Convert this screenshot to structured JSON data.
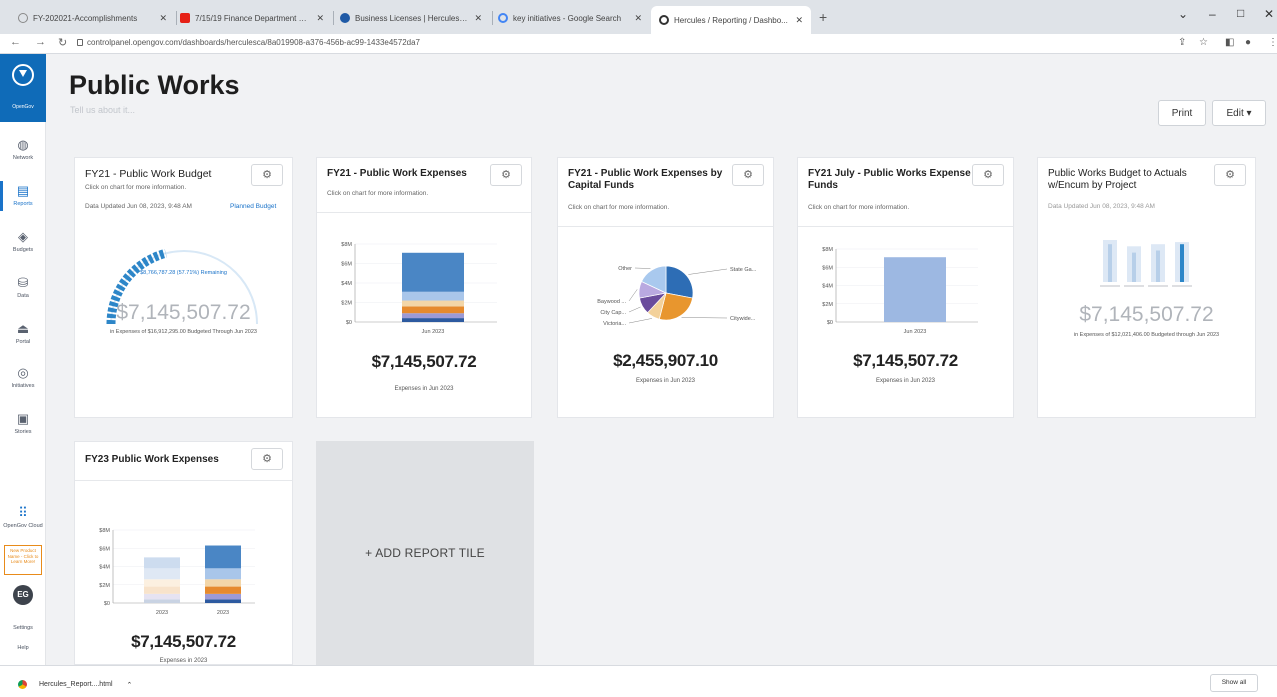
{
  "browser": {
    "tabs": [
      {
        "title": "FY-202021-Accomplishments",
        "icon_color": "#6b7280"
      },
      {
        "title": "7/15/19 Finance Department St...",
        "icon_color": "#e62117"
      },
      {
        "title": "Business Licenses | Hercules, CA",
        "icon_color": "#1f5aa6"
      },
      {
        "title": "key initiatives - Google Search",
        "icon_color": "#4285f4"
      },
      {
        "title": "Hercules / Reporting / Dashbo...",
        "icon_color": "#333333"
      }
    ],
    "new_tab": "+",
    "url": "controlpanel.opengov.com/dashboards/herculesca/8a019908-a376-456b-ac99-1433e4572da7"
  },
  "nav": {
    "brand": "OpenGov",
    "items": [
      {
        "label": "Network",
        "icon": "globe-icon"
      },
      {
        "label": "Reports",
        "icon": "report-icon",
        "active": true
      },
      {
        "label": "Budgets",
        "icon": "budget-icon"
      },
      {
        "label": "Data",
        "icon": "database-icon"
      },
      {
        "label": "Portal",
        "icon": "portal-icon"
      },
      {
        "label": "Initiatives",
        "icon": "target-icon"
      },
      {
        "label": "Stories",
        "icon": "stories-icon"
      }
    ],
    "cloud_label": "OpenGov Cloud",
    "promo": "New Product Name - Click to Learn More!",
    "avatar": "EG",
    "settings": "Settings",
    "help": "Help"
  },
  "header": {
    "title": "Public Works",
    "subtitle": "Tell us about it...",
    "print_label": "Print",
    "edit_label": "Edit ▾"
  },
  "tiles": {
    "t1": {
      "title": "FY21 - Public Work Budget",
      "sub": "Click on chart for more information.",
      "meta": "Data Updated Jun 08, 2023, 9:48 AM",
      "meta_link": "Planned Budget",
      "remaining": "$8,766,787.28 (57.71%) Remaining",
      "amount": "$7,145,507.72",
      "fine": "in Expenses of $16,912,295.00 Budgeted Through Jun 2023",
      "gauge_fraction": 0.42
    },
    "t2": {
      "title": "FY21 - Public Work Expenses",
      "sub": "Click on chart for more information.",
      "amount": "$7,145,507.72",
      "caption": "Expenses in Jun 2023"
    },
    "t3": {
      "title": "FY21 - Public Work Expenses by Capital Funds",
      "sub": "Click on chart for more information.",
      "amount": "$2,455,907.10",
      "caption": "Expenses in Jun 2023"
    },
    "t4": {
      "title": "FY21 July - Public Works Expense Funds",
      "sub": "Click on chart for more information.",
      "amount": "$7,145,507.72",
      "caption": "Expenses in Jun 2023"
    },
    "t5": {
      "title": "Public Works Budget to Actuals w/Encum by Project",
      "meta": "Data Updated Jun 08, 2023, 9:48 AM",
      "amount": "$7,145,507.72",
      "fine": "in Expenses of $12,021,406.00 Budgeted through Jun 2023"
    },
    "t6": {
      "title": "FY23 Public Work Expenses",
      "amount": "$7,145,507.72",
      "caption": "Expenses in 2023"
    }
  },
  "add_tile": "+ ADD REPORT TILE",
  "download": {
    "file": "Hercules_Report....html",
    "show_all": "Show all"
  },
  "chart_data": [
    {
      "type": "bar",
      "name": "FY21 - Public Work Expenses",
      "categories": [
        "Jun 2023"
      ],
      "y_ticks": [
        "$8M",
        "$6M",
        "$4M",
        "$2M",
        "$0"
      ],
      "ylim": [
        0,
        8
      ],
      "series": [
        {
          "values": [
            0.4
          ],
          "color": "#2d5aa0"
        },
        {
          "values": [
            0.5
          ],
          "color": "#9c9ad6"
        },
        {
          "values": [
            0.7
          ],
          "color": "#e68a2e"
        },
        {
          "values": [
            0.6
          ],
          "color": "#f3d6a8"
        },
        {
          "values": [
            0.9
          ],
          "color": "#a9c6ea"
        },
        {
          "values": [
            4.0
          ],
          "color": "#4a86c5"
        }
      ]
    },
    {
      "type": "pie",
      "name": "FY21 - Public Work Expenses by Capital Funds",
      "labels": [
        "State Ga...",
        "Citywide...",
        "Victoria...",
        "City Cap...",
        "Baywood ...",
        "Other"
      ],
      "values": [
        28,
        26,
        8,
        10,
        10,
        18
      ],
      "colors": [
        "#2d6db5",
        "#e8962e",
        "#f3d19a",
        "#6a4c9c",
        "#b9a9e0",
        "#a9c9ee"
      ]
    },
    {
      "type": "bar",
      "name": "FY21 July - Public Works Expense Funds",
      "categories": [
        "Jun 2023"
      ],
      "y_ticks": [
        "$8M",
        "$6M",
        "$4M",
        "$2M",
        "$0"
      ],
      "ylim": [
        0,
        8
      ],
      "series": [
        {
          "values": [
            7.1
          ],
          "color": "#9db8e2"
        }
      ]
    },
    {
      "type": "bar",
      "name": "Public Works Budget to Actuals w/Encum by Project",
      "categories": [
        "",
        "",
        "",
        ""
      ],
      "series": [
        {
          "name": "budget",
          "values": [
            1.0,
            0.85,
            0.9,
            0.95
          ],
          "color": "#dde8f5"
        },
        {
          "name": "actual",
          "values": [
            0.9,
            0.7,
            0.75,
            0.9
          ],
          "color": "#b7cfe9"
        }
      ]
    },
    {
      "type": "bar",
      "name": "FY23 Public Work Expenses",
      "categories": [
        "2023",
        "2023"
      ],
      "y_ticks": [
        "$8M",
        "$6M",
        "$4M",
        "$2M",
        "$0"
      ],
      "ylim": [
        0,
        8
      ],
      "series": [
        {
          "values": [
            0.4,
            0.4
          ],
          "colors": [
            "#c9d3e3",
            "#2d5aa0"
          ]
        },
        {
          "values": [
            0.6,
            0.6
          ],
          "colors": [
            "#e6e3f2",
            "#9c9ad6"
          ]
        },
        {
          "values": [
            0.8,
            0.8
          ],
          "colors": [
            "#f8e3cb",
            "#e68a2e"
          ]
        },
        {
          "values": [
            0.8,
            0.8
          ],
          "colors": [
            "#fcf0e0",
            "#f3d6a8"
          ]
        },
        {
          "values": [
            1.2,
            1.2
          ],
          "colors": [
            "#dfe8f4",
            "#a9c6ea"
          ]
        },
        {
          "values": [
            1.2,
            2.5
          ],
          "colors": [
            "#cddcef",
            "#4a86c5"
          ]
        }
      ]
    }
  ]
}
